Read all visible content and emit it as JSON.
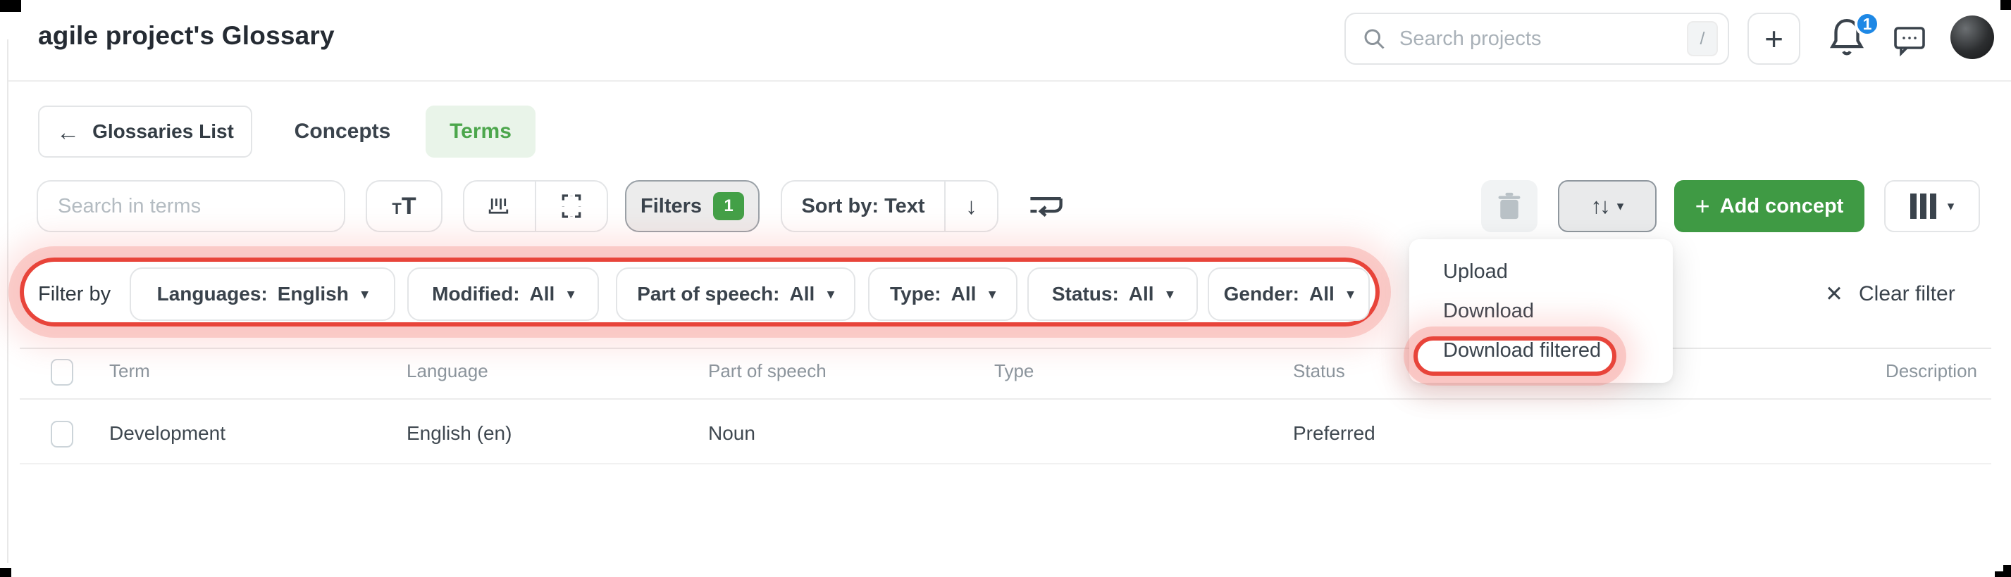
{
  "header": {
    "title": "agile project's Glossary",
    "search_placeholder": "Search projects",
    "search_shortcut": "/",
    "notification_count": "1"
  },
  "nav": {
    "back_label": "Glossaries List",
    "tabs": [
      {
        "label": "Concepts"
      },
      {
        "label": "Terms"
      }
    ]
  },
  "toolbar": {
    "search_placeholder": "Search in terms",
    "filters_label": "Filters",
    "filters_count": "1",
    "sort_label": "Sort by: Text",
    "add_label": "Add concept"
  },
  "filter_bar": {
    "label": "Filter by",
    "pills": [
      {
        "label": "Languages:",
        "value": "English"
      },
      {
        "label": "Modified:",
        "value": "All"
      },
      {
        "label": "Part of speech:",
        "value": "All"
      },
      {
        "label": "Type:",
        "value": "All"
      },
      {
        "label": "Status:",
        "value": "All"
      },
      {
        "label": "Gender:",
        "value": "All"
      }
    ],
    "clear_label": "Clear filter"
  },
  "menu": {
    "items": [
      "Upload",
      "Download",
      "Download filtered"
    ],
    "highlighted": "Download filtered"
  },
  "table": {
    "columns": [
      "Term",
      "Language",
      "Part of speech",
      "Type",
      "Status",
      "Description"
    ],
    "rows": [
      {
        "term": "Development",
        "language": "English (en)",
        "part_of_speech": "Noun",
        "type": "",
        "status": "Preferred",
        "description": ""
      }
    ]
  },
  "icons": {
    "plus": "+",
    "back_arrow": "←",
    "close": "✕",
    "caret": "▾",
    "sort_desc": "↓",
    "updown": "↑↓"
  },
  "colors": {
    "accent_green": "#43a047",
    "active_tab_bg": "#e9f4e9",
    "badge_blue": "#1e88e5",
    "annotation_red": "#e8443a"
  }
}
